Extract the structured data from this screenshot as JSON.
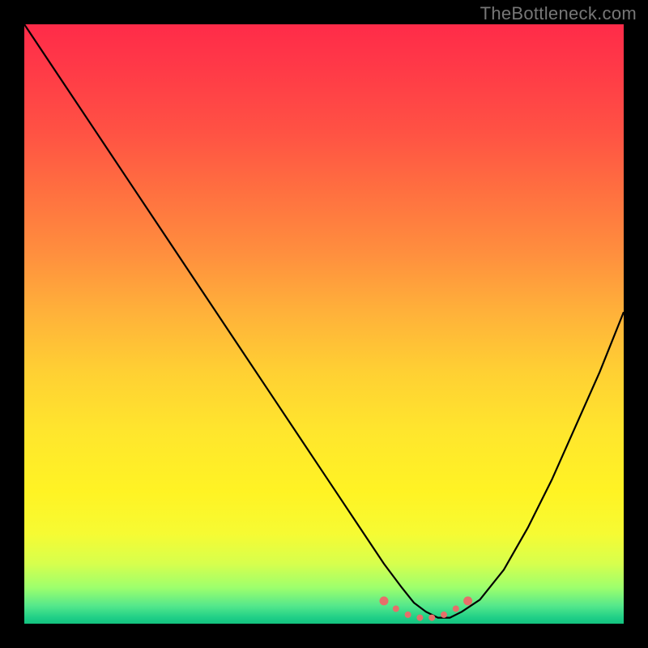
{
  "watermark": "TheBottleneck.com",
  "chart_data": {
    "type": "line",
    "title": "",
    "xlabel": "",
    "ylabel": "",
    "xlim": [
      0,
      100
    ],
    "ylim": [
      0,
      100
    ],
    "series": [
      {
        "name": "bottleneck-curve",
        "x": [
          0,
          6,
          12,
          18,
          24,
          30,
          36,
          42,
          48,
          52,
          56,
          60,
          63,
          65,
          67,
          69,
          71,
          73,
          76,
          80,
          84,
          88,
          92,
          96,
          100
        ],
        "values": [
          100,
          91,
          82,
          73,
          64,
          55,
          46,
          37,
          28,
          22,
          16,
          10,
          6,
          3.5,
          2,
          1,
          1,
          2,
          4,
          9,
          16,
          24,
          33,
          42,
          52
        ]
      }
    ],
    "markers": {
      "name": "recommended-range",
      "color": "#e66f6a",
      "points_x": [
        60,
        62,
        64,
        66,
        68,
        70,
        72,
        74
      ],
      "points_y": [
        3.8,
        2.5,
        1.5,
        1.0,
        1.0,
        1.5,
        2.5,
        3.8
      ]
    },
    "gradient_stops": [
      {
        "pct": 0,
        "color": "#ff2b49"
      },
      {
        "pct": 50,
        "color": "#ffc936"
      },
      {
        "pct": 80,
        "color": "#fff324"
      },
      {
        "pct": 100,
        "color": "#14c27f"
      }
    ]
  }
}
